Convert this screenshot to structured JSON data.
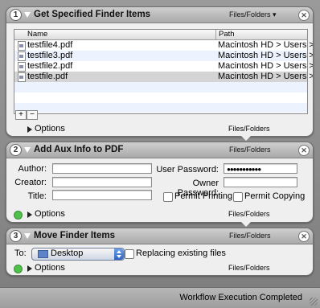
{
  "actions": [
    {
      "number": "1",
      "title": "Get Specified Finder Items",
      "types": "Files/Folders ▾",
      "columns": {
        "name": "Name",
        "path": "Path"
      },
      "files": [
        {
          "name": "testfile4.pdf",
          "path": "Macintosh HD > Users >"
        },
        {
          "name": "testfile3.pdf",
          "path": "Macintosh HD > Users >"
        },
        {
          "name": "testfile2.pdf",
          "path": "Macintosh HD > Users >"
        },
        {
          "name": "testfile.pdf",
          "path": "Macintosh HD > Users >"
        }
      ],
      "add_label": "+",
      "remove_label": "−",
      "options_label": "Options",
      "footer_type": "Files/Folders"
    },
    {
      "number": "2",
      "title": "Add Aux Info to PDF",
      "types": "Files/Folders",
      "author_label": "Author:",
      "author_value": "",
      "creator_label": "Creator:",
      "creator_value": "",
      "title_label": "Title:",
      "title_value": "",
      "user_password_label": "User Password:",
      "user_password_value": "●●●●●●●●●●●",
      "owner_password_label": "Owner Password:",
      "owner_password_value": "",
      "permit_printing_label": "Permit Printing",
      "permit_printing_checked": false,
      "permit_copying_label": "Permit Copying",
      "permit_copying_checked": false,
      "options_label": "Options",
      "footer_type": "Files/Folders"
    },
    {
      "number": "3",
      "title": "Move Finder Items",
      "types": "Files/Folders",
      "to_label": "To:",
      "destination": "Desktop",
      "replacing_label": "Replacing existing files",
      "replacing_checked": false,
      "options_label": "Options",
      "footer_type": "Files/Folders"
    }
  ],
  "status": "Workflow Execution Completed",
  "icons": {
    "close": "close-icon",
    "disclosure": "disclosure-triangle-icon",
    "file": "pdf-file-icon",
    "folder": "folder-icon",
    "success": "green-check-icon"
  },
  "colors": {
    "selected_row": "#d4d4d4",
    "alt_row": "#edf3fe",
    "success": "#4fc04a"
  }
}
